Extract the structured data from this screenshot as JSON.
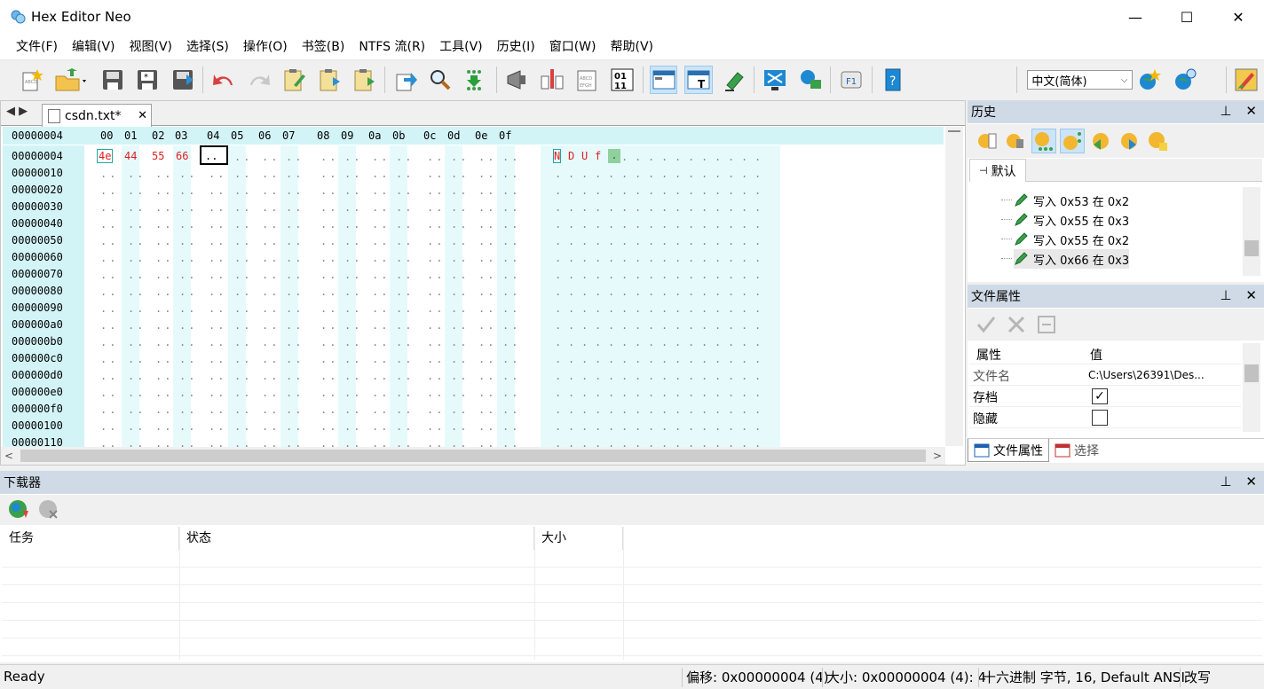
{
  "window": {
    "title": "Hex Editor Neo",
    "minimize": "—",
    "maximize": "☐",
    "close": "✕"
  },
  "menu": [
    "文件(F)",
    "编辑(V)",
    "视图(V)",
    "选择(S)",
    "操作(O)",
    "书签(B)",
    "NTFS 流(R)",
    "工具(V)",
    "历史(I)",
    "窗口(W)",
    "帮助(V)"
  ],
  "toolbar": {
    "language": "中文(简体)"
  },
  "editor": {
    "tab_label": "csdn.txt*",
    "tab_close": "✕",
    "nav_arrows": "◀ ▶",
    "address_header": "00000004",
    "column_headers": [
      "00",
      "01",
      "02",
      "03",
      "04",
      "05",
      "06",
      "07",
      "08",
      "09",
      "0a",
      "0b",
      "0c",
      "0d",
      "0e",
      "0f"
    ],
    "addresses": [
      "00000004",
      "00000010",
      "00000020",
      "00000030",
      "00000040",
      "00000050",
      "00000060",
      "00000070",
      "00000080",
      "00000090",
      "000000a0",
      "000000b0",
      "000000c0",
      "000000d0",
      "000000e0",
      "000000f0",
      "00000100",
      "00000110"
    ],
    "first_row_bytes": [
      "4e",
      "44",
      "55",
      "66"
    ],
    "cursor_placeholder": "..",
    "empty_cell": "..",
    "first_row_chars": [
      "N",
      "D",
      "U",
      "f"
    ],
    "empty_char": "."
  },
  "history": {
    "title": "历史",
    "tab": "默认",
    "items": [
      {
        "label": "写入 0x53 在 0x2"
      },
      {
        "label": "写入 0x55 在 0x3"
      },
      {
        "label": "写入 0x55 在 0x2"
      },
      {
        "label": "写入 0x66 在 0x3"
      }
    ]
  },
  "file_properties": {
    "title": "文件属性",
    "col_attr": "属性",
    "col_value": "值",
    "rows": [
      {
        "name": "文件名",
        "value": "C:\\Users\\26391\\Des..."
      },
      {
        "name": "存档",
        "checked": "✓"
      },
      {
        "name": "隐藏",
        "checked": ""
      }
    ],
    "tab_props": "文件属性",
    "tab_select": "选择"
  },
  "downloader": {
    "title": "下载器",
    "columns": [
      "任务",
      "状态",
      "大小"
    ]
  },
  "status": {
    "ready": "Ready",
    "offset": "偏移: 0x00000004 (4)",
    "size": "大小: 0x00000004 (4): 4",
    "mode": "十六进制 字节, 16, Default ANSI",
    "overwrite": "改写"
  },
  "panel_buttons": {
    "pin": "⊥",
    "close": "✕"
  }
}
